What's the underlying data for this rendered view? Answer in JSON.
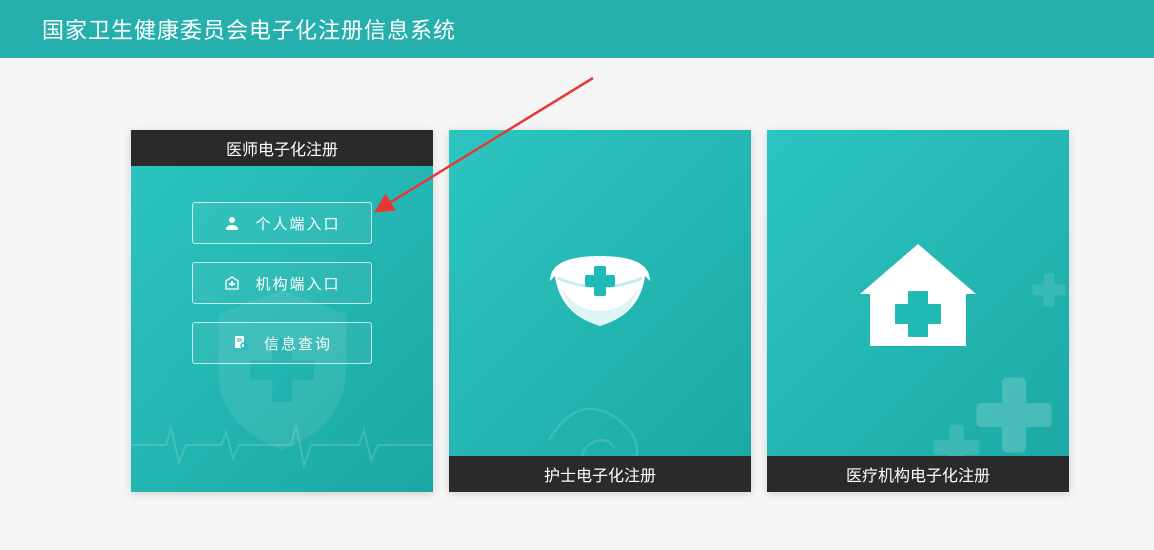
{
  "header": {
    "title": "国家卫生健康委员会电子化注册信息系统"
  },
  "cards": [
    {
      "title": "医师电子化注册",
      "buttons": [
        {
          "icon": "user-icon",
          "label": "个人端入口"
        },
        {
          "icon": "building-icon",
          "label": "机构端入口"
        },
        {
          "icon": "search-doc-icon",
          "label": "信息查询"
        }
      ]
    },
    {
      "title": "护士电子化注册",
      "icon": "nurse-cap-icon"
    },
    {
      "title": "医疗机构电子化注册",
      "icon": "medical-house-icon"
    }
  ],
  "colors": {
    "headerBg": "#26b0ad",
    "cardBg": "#1fbab6",
    "cardHeaderBg": "#2a2a2a",
    "arrow": "#e53935"
  }
}
